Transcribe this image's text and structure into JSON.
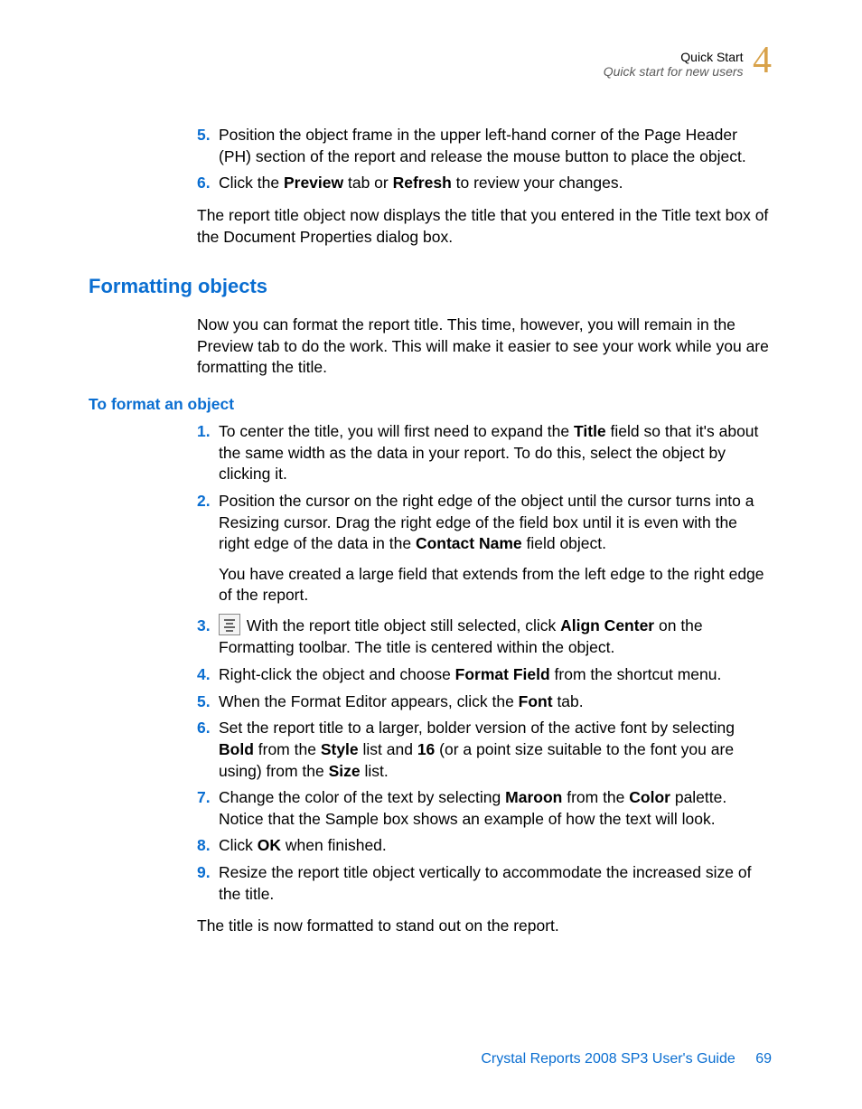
{
  "header": {
    "line1": "Quick Start",
    "line2": "Quick start for new users",
    "chapter": "4"
  },
  "intro_steps": {
    "s5": {
      "num": "5.",
      "prefix": "Position the object frame in the upper left-hand corner of the Page Header (PH) section of the report and release the mouse button to place the object."
    },
    "s6": {
      "num": "6.",
      "t1": "Click the ",
      "b1": "Preview",
      "t2": " tab or ",
      "b2": "Refresh",
      "t3": " to review your changes."
    }
  },
  "intro_para": "The report title object now displays the title that you entered in the Title text box of the Document Properties dialog box.",
  "heading2": "Formatting objects",
  "section_intro": "Now you can format the report title. This time, however, you will remain in the Preview tab to do the work. This will make it easier to see your work while you are formatting the title.",
  "heading3": "To format an object",
  "steps": {
    "s1": {
      "num": "1.",
      "t1": "To center the title, you will first need to expand the ",
      "b1": "Title",
      "t2": " field so that it's about the same width as the data in your report. To do this, select the object by clicking it."
    },
    "s2": {
      "num": "2.",
      "t1": "Position the cursor on the right edge of the object until the cursor turns into a Resizing cursor. Drag the right edge of the field box until it is even with the right edge of the data in the ",
      "b1": "Contact Name",
      "t2": " field object."
    },
    "s2_sub": "You have created a large field that extends from the left edge to the right edge of the report.",
    "s3": {
      "num": "3.",
      "t1": " With the report title object still selected, click ",
      "b1": "Align Center",
      "t2": " on the Formatting toolbar. The title is centered within the object."
    },
    "s4": {
      "num": "4.",
      "t1": "Right-click the object and choose ",
      "b1": "Format Field",
      "t2": " from the shortcut menu."
    },
    "s5": {
      "num": "5.",
      "t1": "When the Format Editor appears, click the ",
      "b1": "Font",
      "t2": " tab."
    },
    "s6": {
      "num": "6.",
      "t1": "Set the report title to a larger, bolder version of the active font by selecting ",
      "b1": "Bold",
      "t2": " from the ",
      "b2": "Style",
      "t3": " list and ",
      "b3": "16",
      "t4": " (or a point size suitable to the font you are using) from the ",
      "b4": "Size",
      "t5": " list."
    },
    "s7": {
      "num": "7.",
      "t1": "Change the color of the text by selecting ",
      "b1": "Maroon",
      "t2": " from the ",
      "b2": "Color",
      "t3": " palette. Notice that the Sample box shows an example of how the text will look."
    },
    "s8": {
      "num": "8.",
      "t1": "Click ",
      "b1": "OK",
      "t2": " when finished."
    },
    "s9": {
      "num": "9.",
      "t1": "Resize the report title object vertically to accommodate the increased size of the title."
    }
  },
  "closing": "The title is now formatted to stand out on the report.",
  "footer": {
    "title": "Crystal Reports 2008 SP3 User's Guide",
    "page": "69"
  }
}
